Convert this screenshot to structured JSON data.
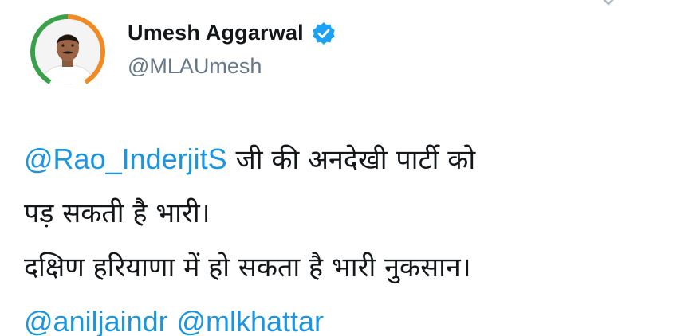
{
  "user": {
    "display_name": "Umesh Aggarwal",
    "handle": "@MLAUmesh",
    "verified": true
  },
  "tweet": {
    "line1": {
      "mention": "@Rao_InderjitS",
      "text": " जी  की अनदेखी पार्टी को"
    },
    "line2": "पड़ सकती है भारी।",
    "line3": "दक्षिण हरियाणा में हो सकता है भारी नुकसान।",
    "line4": {
      "mention1": "@aniljaindr",
      "mention2": "@mlkhattar"
    }
  },
  "icons": {
    "avatar": "profile-photo",
    "verified": "verified-badge-icon",
    "menu": "chevron-down-icon"
  },
  "colors": {
    "link": "#1b95e0",
    "name": "#14171a",
    "handle": "#657786",
    "verified": "#1da1f2"
  }
}
